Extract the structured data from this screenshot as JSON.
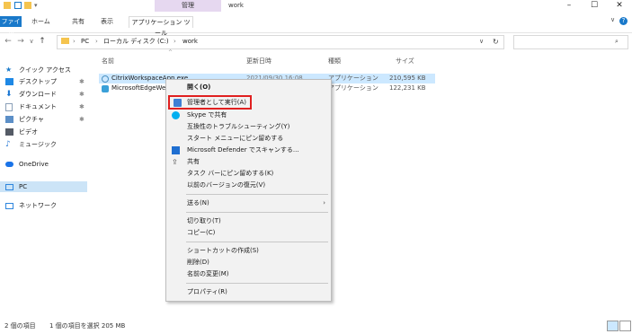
{
  "titlebar": {
    "context_tab": "管理",
    "window_title": "work",
    "min": "–",
    "max": "☐",
    "close": "✕"
  },
  "ribbon": {
    "tabs": [
      "ファイル",
      "ホーム",
      "共有",
      "表示"
    ],
    "app_tools": "アプリケーション ツール",
    "help": "?",
    "collapse": "∨"
  },
  "address": {
    "back": "←",
    "forward": "→",
    "recent": "∨",
    "up": "↑",
    "crumbs": [
      "PC",
      "ローカル ディスク (C:)",
      "work"
    ],
    "sep": "›",
    "dropdown": "∨",
    "refresh": "↻",
    "search_icon": "⌕"
  },
  "nav": {
    "items": [
      {
        "label": "クイック アクセス",
        "icon": "star-icon",
        "color": "#1979ca"
      },
      {
        "label": "デスクトップ",
        "icon": "desktop-icon",
        "color": "#1e88e5",
        "pin": "✱"
      },
      {
        "label": "ダウンロード",
        "icon": "download-icon",
        "color": "#1976d2",
        "pin": "✱"
      },
      {
        "label": "ドキュメント",
        "icon": "document-icon",
        "color": "#8aa0b8",
        "pin": "✱"
      },
      {
        "label": "ピクチャ",
        "icon": "pictures-icon",
        "color": "#5c8fc7",
        "pin": "✱"
      },
      {
        "label": "ビデオ",
        "icon": "video-icon",
        "color": "#555b66"
      },
      {
        "label": "ミュージック",
        "icon": "music-icon",
        "color": "#2e7dd7"
      },
      {
        "label": "OneDrive",
        "icon": "cloud-icon",
        "color": "#1a73e8"
      },
      {
        "label": "PC",
        "icon": "pc-icon",
        "color": "#2e86de"
      },
      {
        "label": "ネットワーク",
        "icon": "network-icon",
        "color": "#2e86de"
      }
    ]
  },
  "list": {
    "headers": {
      "name": "名前",
      "modified": "更新日時",
      "type": "種類",
      "size": "サイズ"
    },
    "sort_arrow": "^",
    "rows": [
      {
        "name": "CitrixWorkspaceApp.exe",
        "modified": "2021/09/30 16:08",
        "type": "アプリケーション",
        "size": "210,595 KB"
      },
      {
        "name": "MicrosoftEdgeWebView2...",
        "modified": "",
        "type": "アプリケーション",
        "size": "122,231 KB"
      }
    ]
  },
  "status": {
    "count": "2 個の項目",
    "selected": "1 個の項目を選択 205 MB"
  },
  "context_menu": {
    "items": [
      {
        "label": "開く(O)"
      },
      {
        "label": "管理者として実行(A)",
        "highlighted": true
      },
      {
        "label": "Skype で共有"
      },
      {
        "label": "互換性のトラブルシューティング(Y)"
      },
      {
        "label": "スタート メニューにピン留めする"
      },
      {
        "label": "Microsoft Defender でスキャンする..."
      },
      {
        "label": "共有"
      },
      {
        "label": "タスク バーにピン留めする(K)"
      },
      {
        "label": "以前のバージョンの復元(V)"
      },
      {
        "label": "送る(N)",
        "submenu": "›"
      },
      {
        "label": "切り取り(T)"
      },
      {
        "label": "コピー(C)"
      },
      {
        "label": "ショートカットの作成(S)"
      },
      {
        "label": "削除(D)"
      },
      {
        "label": "名前の変更(M)"
      },
      {
        "label": "プロパティ(R)"
      }
    ]
  },
  "colors": {
    "accent": "#1979ca",
    "selection": "#cce8ff",
    "highlight_border": "#e02020",
    "context_tab": "#e6d8f0"
  }
}
